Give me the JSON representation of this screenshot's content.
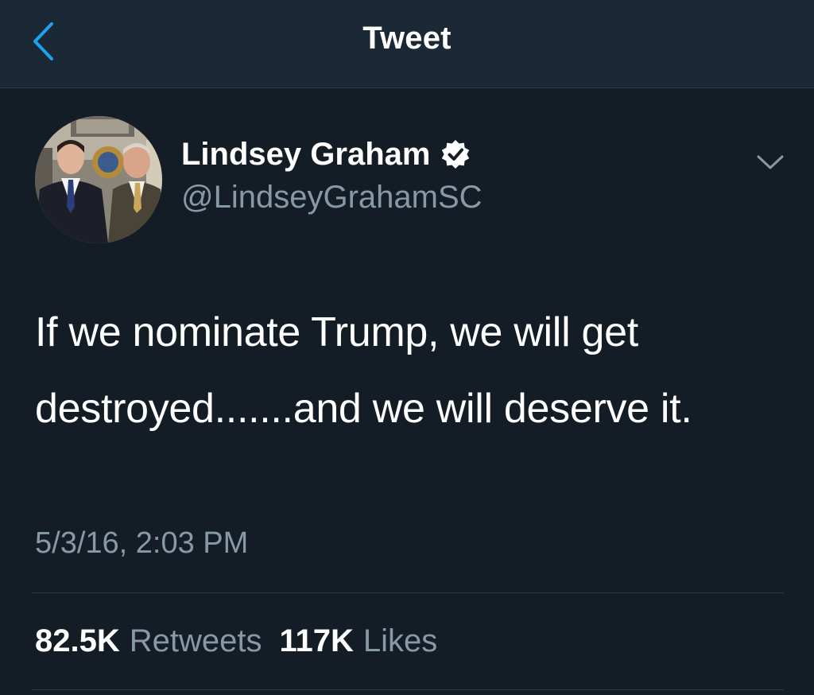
{
  "nav": {
    "title": "Tweet",
    "back_icon": "chevron-left-icon"
  },
  "author": {
    "display_name": "Lindsey Graham",
    "handle": "@LindseyGrahamSC",
    "verified": true,
    "verified_icon": "verified-badge-icon"
  },
  "tweet": {
    "text": "If we nominate Trump, we will get destroyed.......and we will deserve it.",
    "timestamp": "5/3/16, 2:03 PM",
    "menu_icon": "chevron-down-icon"
  },
  "stats": {
    "retweets_count": "82.5K",
    "retweets_label": "Retweets",
    "likes_count": "117K",
    "likes_label": "Likes"
  },
  "colors": {
    "background": "#141d26",
    "navbar": "#1b2836",
    "accent": "#1da1f2",
    "secondary_text": "#8899a6",
    "divider": "#2f3b47"
  }
}
